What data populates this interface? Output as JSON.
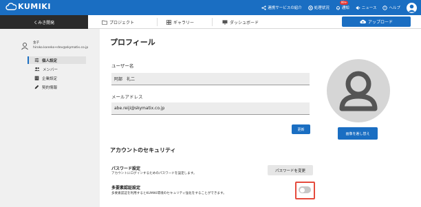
{
  "app": {
    "logo_text": "KUMIKI",
    "top_nav": [
      {
        "label": "連携サービスの紹介",
        "icon": "share-icon"
      },
      {
        "label": "処理状況",
        "icon": "settings-status-icon"
      },
      {
        "label": "通知",
        "icon": "bell-icon",
        "badge": "99+"
      },
      {
        "label": "ニュース",
        "icon": "megaphone-icon"
      },
      {
        "label": "ヘルプ",
        "icon": "help-icon"
      }
    ]
  },
  "subbar": {
    "project_name": "くみき開発",
    "tabs": [
      {
        "label": "プロジェクト",
        "icon": "folder-icon"
      },
      {
        "label": "ギャラリー",
        "icon": "grid-icon"
      },
      {
        "label": "ダッシュボード",
        "icon": "monitor-icon"
      }
    ],
    "upload_label": "アップロード"
  },
  "sidebar": {
    "user_name": "金子",
    "user_email": "hiroko.kaneko+dev@skymatix.co.jp",
    "items": [
      {
        "label": "個人設定",
        "icon": "sliders-icon",
        "active": true
      },
      {
        "label": "メンバー",
        "icon": "people-icon",
        "active": false
      },
      {
        "label": "企業設定",
        "icon": "building-icon",
        "active": false
      },
      {
        "label": "契約情報",
        "icon": "edit-icon",
        "active": false
      }
    ]
  },
  "profile": {
    "title": "プロフィール",
    "username_label": "ユーザー名",
    "username_value": "阿部　礼二",
    "email_label": "メールアドレス",
    "email_value": "abe.reiji@skymatix.co.jp",
    "update_label": "更新",
    "change_image_label": "画像を差し替え"
  },
  "security": {
    "title": "アカウントのセキュリティ",
    "password_title": "パスワード設定",
    "password_desc": "アカウントにログインするためのパスワードを設定します。",
    "password_button": "パスワードを変更",
    "mfa_title": "多要素認証設定",
    "mfa_desc": "多要素認証を利用するとKUMIKI環境のセキュリティ強化をすることができます。",
    "mfa_enabled": false
  },
  "colors": {
    "primary": "#1a6ec2",
    "highlight": "#e54a3c",
    "dark_tab": "#2b2b2b"
  }
}
